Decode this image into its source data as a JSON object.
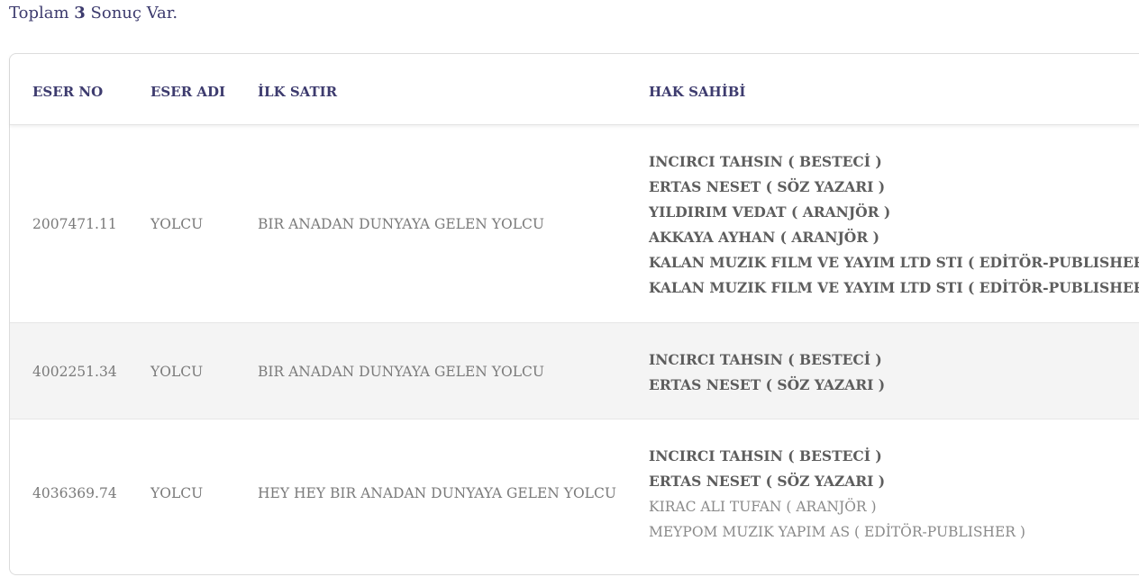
{
  "summary": {
    "prefix": "Toplam",
    "count": "3",
    "suffix": "Sonuç Var."
  },
  "table": {
    "headers": {
      "eser_no": "ESER NO",
      "eser_adi": "ESER ADI",
      "ilk_satir": "İLK SATIR",
      "hak_sahibi": "HAK SAHİBİ"
    },
    "rows": [
      {
        "eser_no": "2007471.11",
        "eser_adi": "YOLCU",
        "ilk_satir": "BIR ANADAN DUNYAYA GELEN YOLCU",
        "owners": [
          "INCIRCI TAHSIN ( BESTECİ )",
          "ERTAS NESET ( SÖZ YAZARI )",
          "YILDIRIM VEDAT ( ARANJÖR )",
          "AKKAYA AYHAN ( ARANJÖR )",
          "KALAN MUZIK FILM VE YAYIM LTD STI ( EDİTÖR-PUBLISHER )",
          "KALAN MUZIK FILM VE YAYIM LTD STI ( EDİTÖR-PUBLISHER )"
        ]
      },
      {
        "eser_no": "4002251.34",
        "eser_adi": "YOLCU",
        "ilk_satir": "BIR ANADAN DUNYAYA GELEN YOLCU",
        "owners": [
          "INCIRCI TAHSIN ( BESTECİ )",
          "ERTAS NESET ( SÖZ YAZARI )"
        ]
      },
      {
        "eser_no": "4036369.74",
        "eser_adi": "YOLCU",
        "ilk_satir": "HEY HEY BIR ANADAN DUNYAYA GELEN YOLCU",
        "owners": [
          "INCIRCI TAHSIN ( BESTECİ )",
          "ERTAS NESET ( SÖZ YAZARI )",
          "KIRAC ALI TUFAN ( ARANJÖR )",
          "MEYPOM MUZIK YAPIM AS ( EDİTÖR-PUBLISHER )"
        ]
      }
    ]
  },
  "colors": {
    "header_text": "#3d3b6e",
    "body_text": "#7a7a7a",
    "owner_bold": "#5d5d5d",
    "row_alt_bg": "#f4f4f4"
  }
}
